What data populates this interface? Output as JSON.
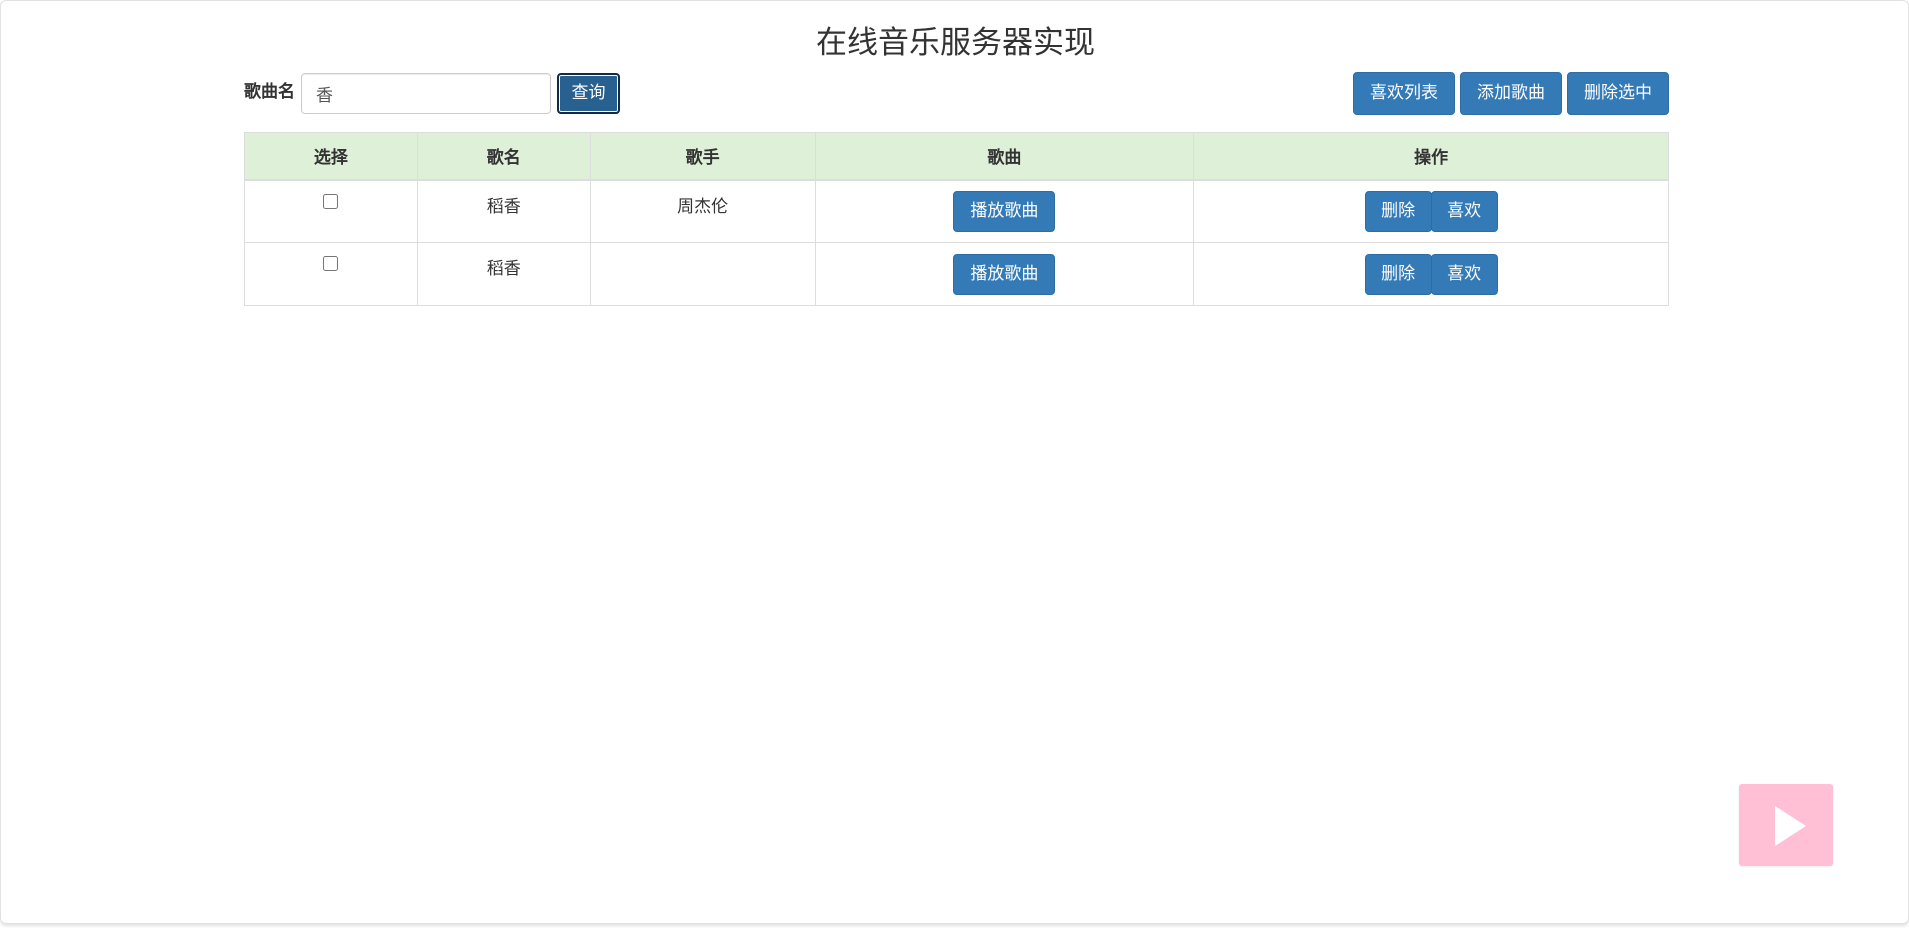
{
  "page": {
    "title": "在线音乐服务器实现"
  },
  "search": {
    "label": "歌曲名",
    "value": "香",
    "query_label": "查询"
  },
  "toolbar": {
    "fav_list_label": "喜欢列表",
    "add_song_label": "添加歌曲",
    "delete_selected_label": "删除选中"
  },
  "table": {
    "headers": [
      "选择",
      "歌名",
      "歌手",
      "歌曲",
      "操作"
    ],
    "rows": [
      {
        "checked": false,
        "title": "稻香",
        "singer": "周杰伦",
        "play_label": "播放歌曲",
        "delete_label": "删除",
        "like_label": "喜欢"
      },
      {
        "checked": false,
        "title": "稻香",
        "singer": "",
        "play_label": "播放歌曲",
        "delete_label": "删除",
        "like_label": "喜欢"
      }
    ]
  },
  "player": {
    "icon": "play-icon"
  },
  "colors": {
    "primary_button": "#337ab7",
    "header_row": "#dff0d8",
    "player_bg": "#ffc0d5"
  }
}
